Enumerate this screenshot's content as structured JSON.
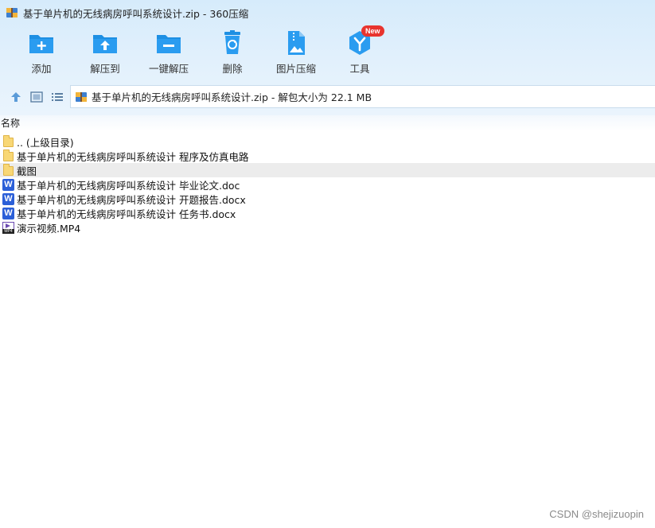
{
  "window": {
    "title": "基于单片机的无线病房呼叫系统设计.zip - 360压缩"
  },
  "toolbar": {
    "items": [
      {
        "label": "添加",
        "icon": "add-folder-icon"
      },
      {
        "label": "解压到",
        "icon": "extract-to-folder-icon"
      },
      {
        "label": "一键解压",
        "icon": "one-click-extract-icon"
      },
      {
        "label": "删除",
        "icon": "recycle-bin-icon"
      },
      {
        "label": "图片压缩",
        "icon": "image-compress-icon"
      },
      {
        "label": "工具",
        "icon": "tools-icon",
        "badge": "New"
      }
    ]
  },
  "navigation": {
    "path": "基于单片机的无线病房呼叫系统设计.zip - 解包大小为 22.1 MB"
  },
  "file_list": {
    "column_name": "名称",
    "rows": [
      {
        "name": ".. (上级目录)",
        "type": "folder"
      },
      {
        "name": "基于单片机的无线病房呼叫系统设计 程序及仿真电路",
        "type": "folder"
      },
      {
        "name": "截图",
        "type": "folder",
        "selected": true
      },
      {
        "name": "基于单片机的无线病房呼叫系统设计 毕业论文.doc",
        "type": "word"
      },
      {
        "name": "基于单片机的无线病房呼叫系统设计 开题报告.docx",
        "type": "word"
      },
      {
        "name": "基于单片机的无线病房呼叫系统设计 任务书.docx",
        "type": "word"
      },
      {
        "name": "演示视频.MP4",
        "type": "video"
      }
    ]
  },
  "watermark": "CSDN @shejizuopin",
  "colors": {
    "accent": "#1d8fe3",
    "badge": "#e8342e",
    "selection": "#ececec"
  }
}
